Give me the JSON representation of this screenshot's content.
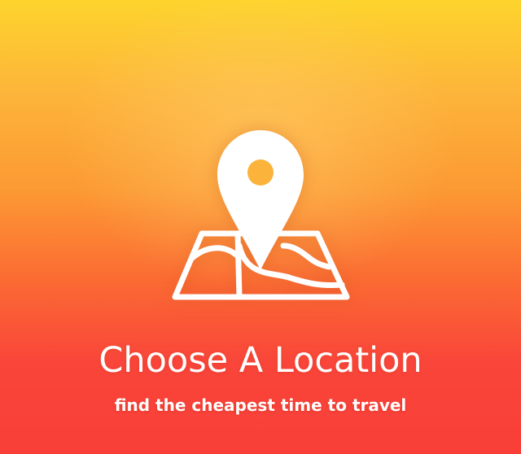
{
  "onboarding": {
    "icon": "map-location-pin-icon",
    "title": "Choose A Location",
    "subtitle": "find the cheapest time to travel"
  },
  "colors": {
    "gradient_top": "#fdd42c",
    "gradient_middle": "#fc9933",
    "gradient_bottom": "#f93f38",
    "foreground": "#ffffff"
  }
}
